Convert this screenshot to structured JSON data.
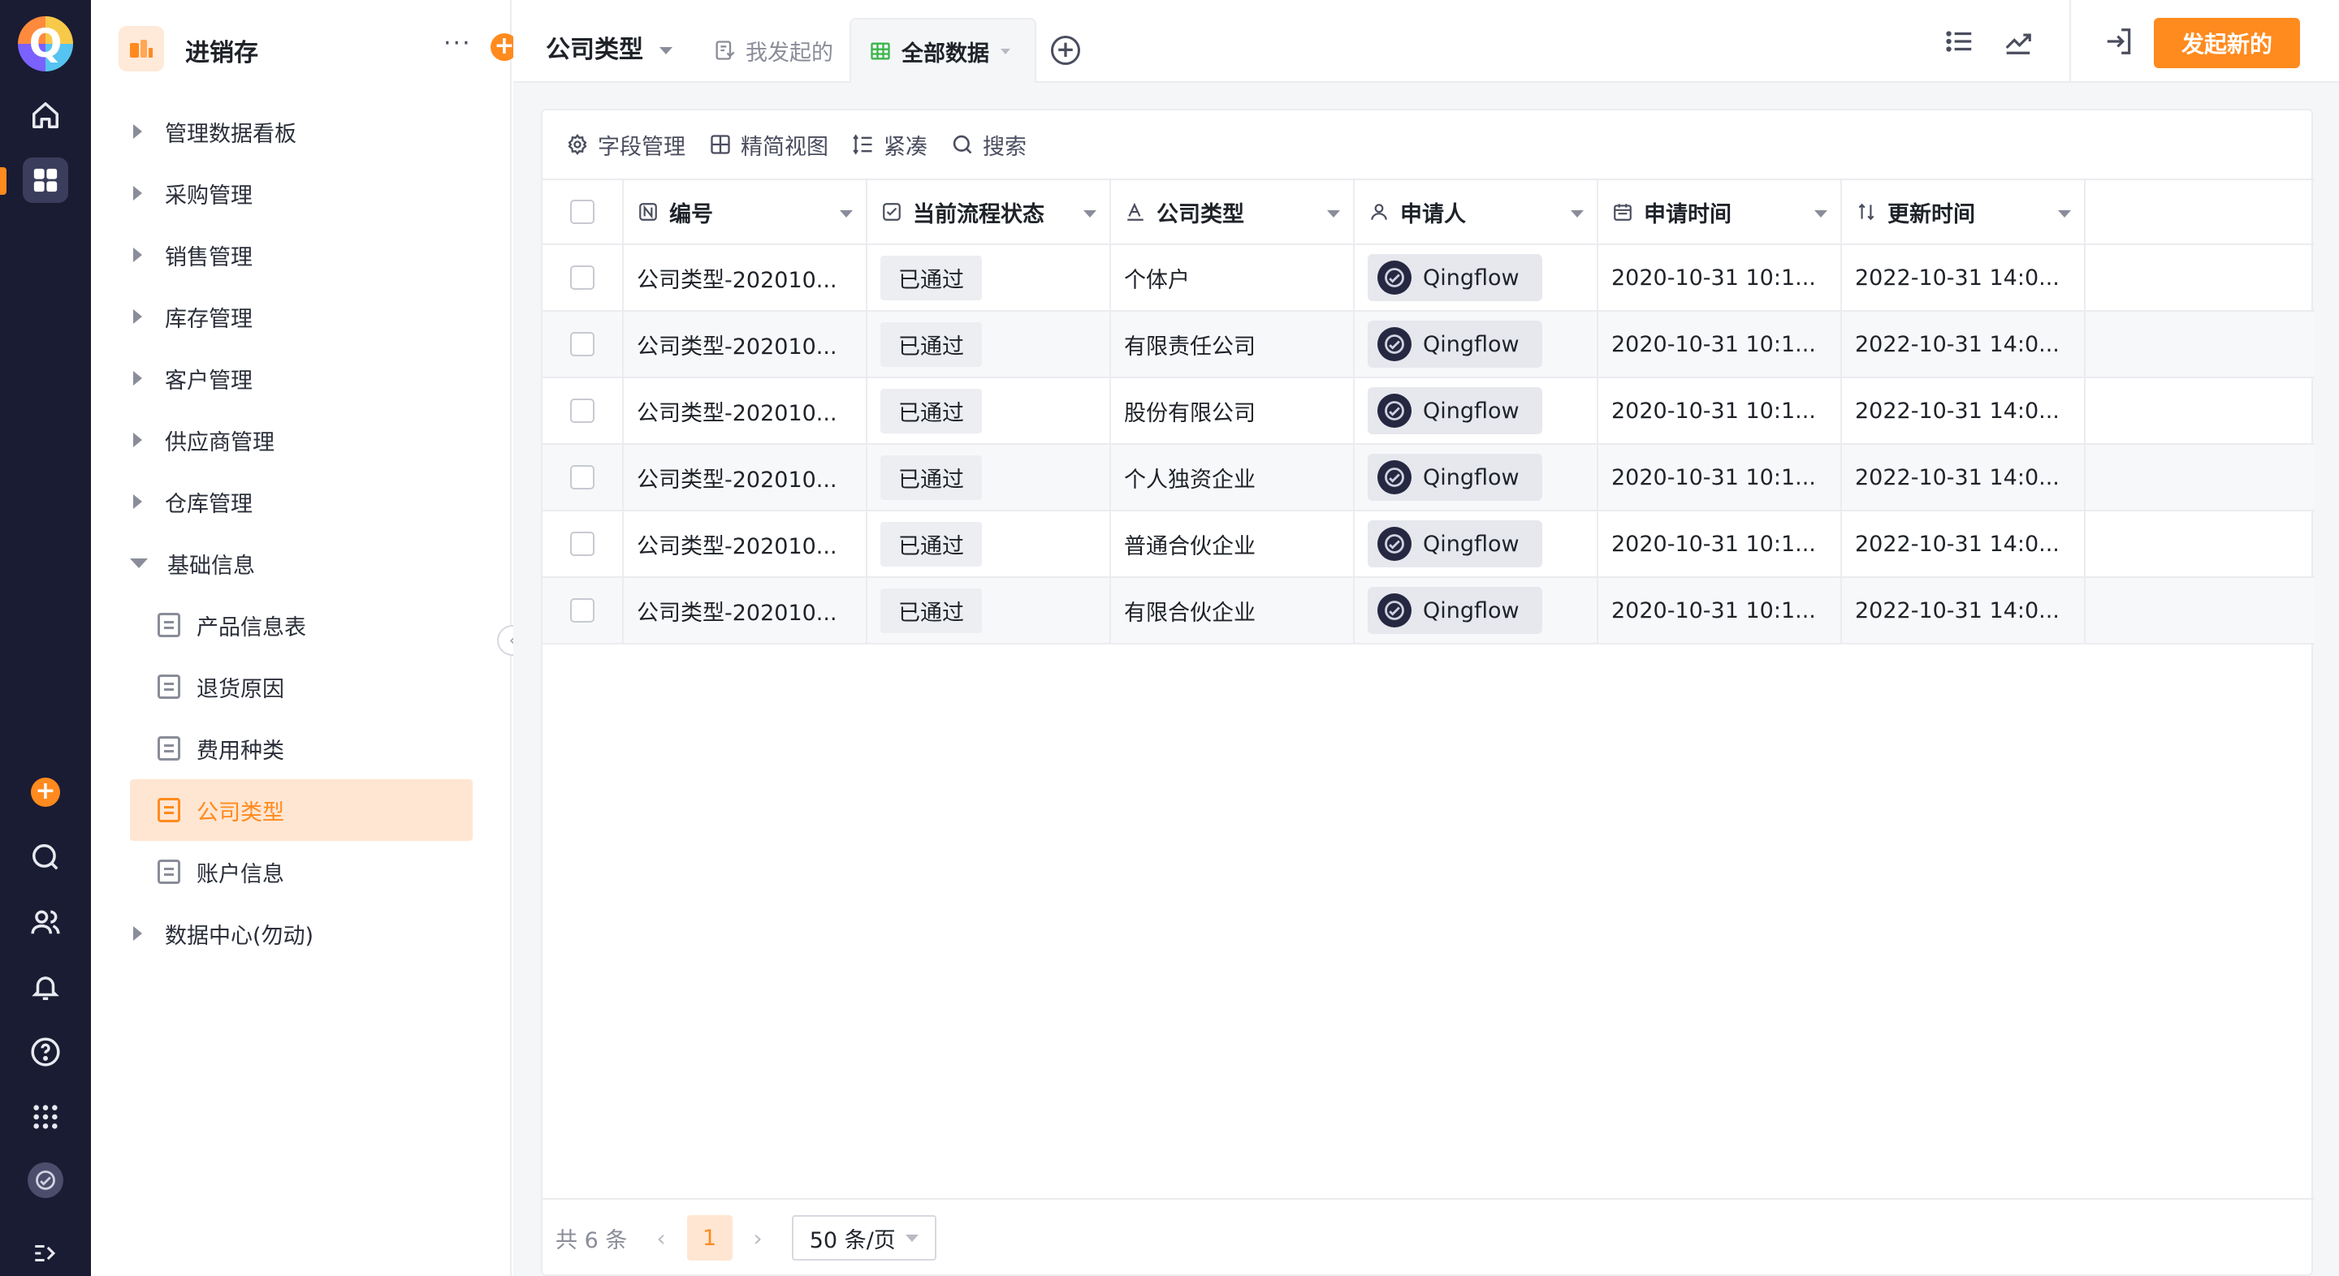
{
  "app": {
    "name": "进销存",
    "more_label": "···",
    "add_label": "+",
    "accent": "#ff8a1e"
  },
  "rail": {
    "logo_letter": "Q",
    "icons": [
      "home-icon",
      "apps-grid-icon",
      "add-icon",
      "search-icon",
      "team-icon",
      "bell-icon",
      "help-icon",
      "app-launcher-icon",
      "avatar",
      "expand-icon"
    ]
  },
  "sidebar": {
    "items": [
      {
        "label": "管理数据看板"
      },
      {
        "label": "采购管理"
      },
      {
        "label": "销售管理"
      },
      {
        "label": "库存管理"
      },
      {
        "label": "客户管理"
      },
      {
        "label": "供应商管理"
      },
      {
        "label": "仓库管理"
      },
      {
        "label": "基础信息",
        "expanded": true
      },
      {
        "label": "数据中心(勿动)"
      }
    ],
    "sub_items": [
      {
        "label": "产品信息表"
      },
      {
        "label": "退货原因"
      },
      {
        "label": "费用种类"
      },
      {
        "label": "公司类型",
        "active": true
      },
      {
        "label": "账户信息"
      }
    ]
  },
  "header": {
    "form_title": "公司类型",
    "tabs": [
      {
        "label": "我发起的",
        "active": false
      },
      {
        "label": "全部数据",
        "active": true
      }
    ],
    "new_button": "发起新的"
  },
  "toolbar": {
    "field_manage": "字段管理",
    "simple_view": "精简视图",
    "compact": "紧凑",
    "search": "搜索"
  },
  "table": {
    "columns": [
      "编号",
      "当前流程状态",
      "公司类型",
      "申请人",
      "申请时间",
      "更新时间"
    ],
    "rows": [
      {
        "id": "公司类型-202010...",
        "status": "已通过",
        "type": "个体户",
        "applicant": "Qingflow",
        "apply_time": "2020-10-31 10:1...",
        "update_time": "2022-10-31 14:0..."
      },
      {
        "id": "公司类型-202010...",
        "status": "已通过",
        "type": "有限责任公司",
        "applicant": "Qingflow",
        "apply_time": "2020-10-31 10:1...",
        "update_time": "2022-10-31 14:0..."
      },
      {
        "id": "公司类型-202010...",
        "status": "已通过",
        "type": "股份有限公司",
        "applicant": "Qingflow",
        "apply_time": "2020-10-31 10:1...",
        "update_time": "2022-10-31 14:0..."
      },
      {
        "id": "公司类型-202010...",
        "status": "已通过",
        "type": "个人独资企业",
        "applicant": "Qingflow",
        "apply_time": "2020-10-31 10:1...",
        "update_time": "2022-10-31 14:0..."
      },
      {
        "id": "公司类型-202010...",
        "status": "已通过",
        "type": "普通合伙企业",
        "applicant": "Qingflow",
        "apply_time": "2020-10-31 10:1...",
        "update_time": "2022-10-31 14:0..."
      },
      {
        "id": "公司类型-202010...",
        "status": "已通过",
        "type": "有限合伙企业",
        "applicant": "Qingflow",
        "apply_time": "2020-10-31 10:1...",
        "update_time": "2022-10-31 14:0..."
      }
    ]
  },
  "pager": {
    "total": "共 6 条",
    "prev": "‹",
    "current": "1",
    "next": "›",
    "page_size": "50 条/页"
  }
}
